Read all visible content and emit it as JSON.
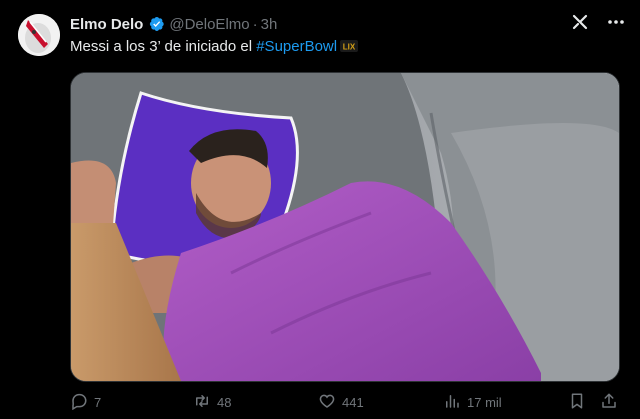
{
  "tweet": {
    "author_name": "Elmo Delo",
    "handle": "@DeloElmo",
    "separator": "·",
    "time": "3h",
    "text_prefix": "Messi a los 3’ de iniciado el ",
    "hashtag": "#SuperBowl",
    "emoji_label": "LIX"
  },
  "actions": {
    "replies": "7",
    "reposts": "48",
    "likes": "441",
    "views": "17 mil"
  },
  "icons": {
    "verified": "verified-badge-icon",
    "grok": "grok-icon",
    "more": "more-icon",
    "reply": "reply-icon",
    "repost": "repost-icon",
    "like": "like-icon",
    "views": "views-icon",
    "bookmark": "bookmark-icon",
    "share": "share-icon"
  },
  "colors": {
    "background": "#000000",
    "text": "#e7e9ea",
    "muted": "#71767b",
    "accent": "#1d9bf0"
  }
}
